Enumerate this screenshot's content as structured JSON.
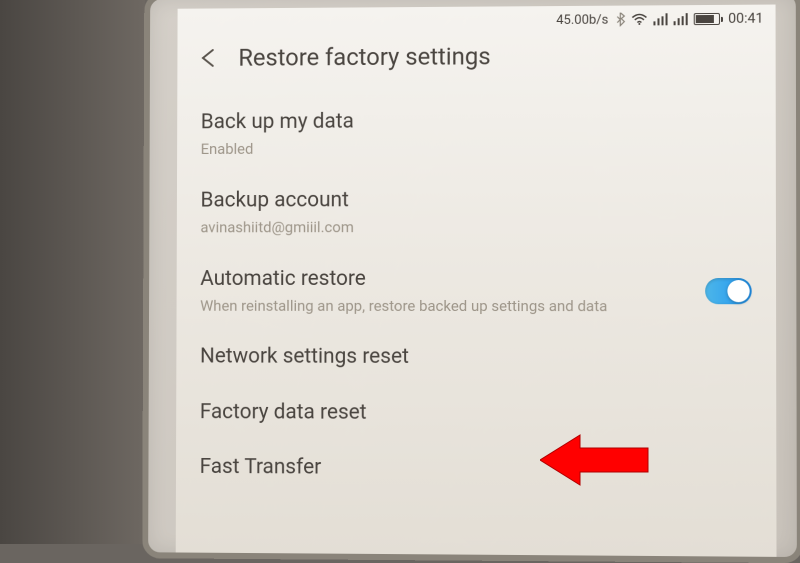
{
  "statusBar": {
    "speed": "45.00b/s",
    "time": "00:41"
  },
  "header": {
    "title": "Restore factory settings"
  },
  "items": {
    "backup": {
      "title": "Back up my data",
      "subtitle": "Enabled"
    },
    "account": {
      "title": "Backup account",
      "subtitle": "avinashiitd@gmiiil.com"
    },
    "autoRestore": {
      "title": "Automatic restore",
      "subtitle": "When reinstalling an app, restore backed up settings and data",
      "enabled": true
    },
    "networkReset": {
      "title": "Network settings reset"
    },
    "factoryReset": {
      "title": "Factory data reset"
    },
    "fastTransfer": {
      "title": "Fast Transfer"
    }
  }
}
